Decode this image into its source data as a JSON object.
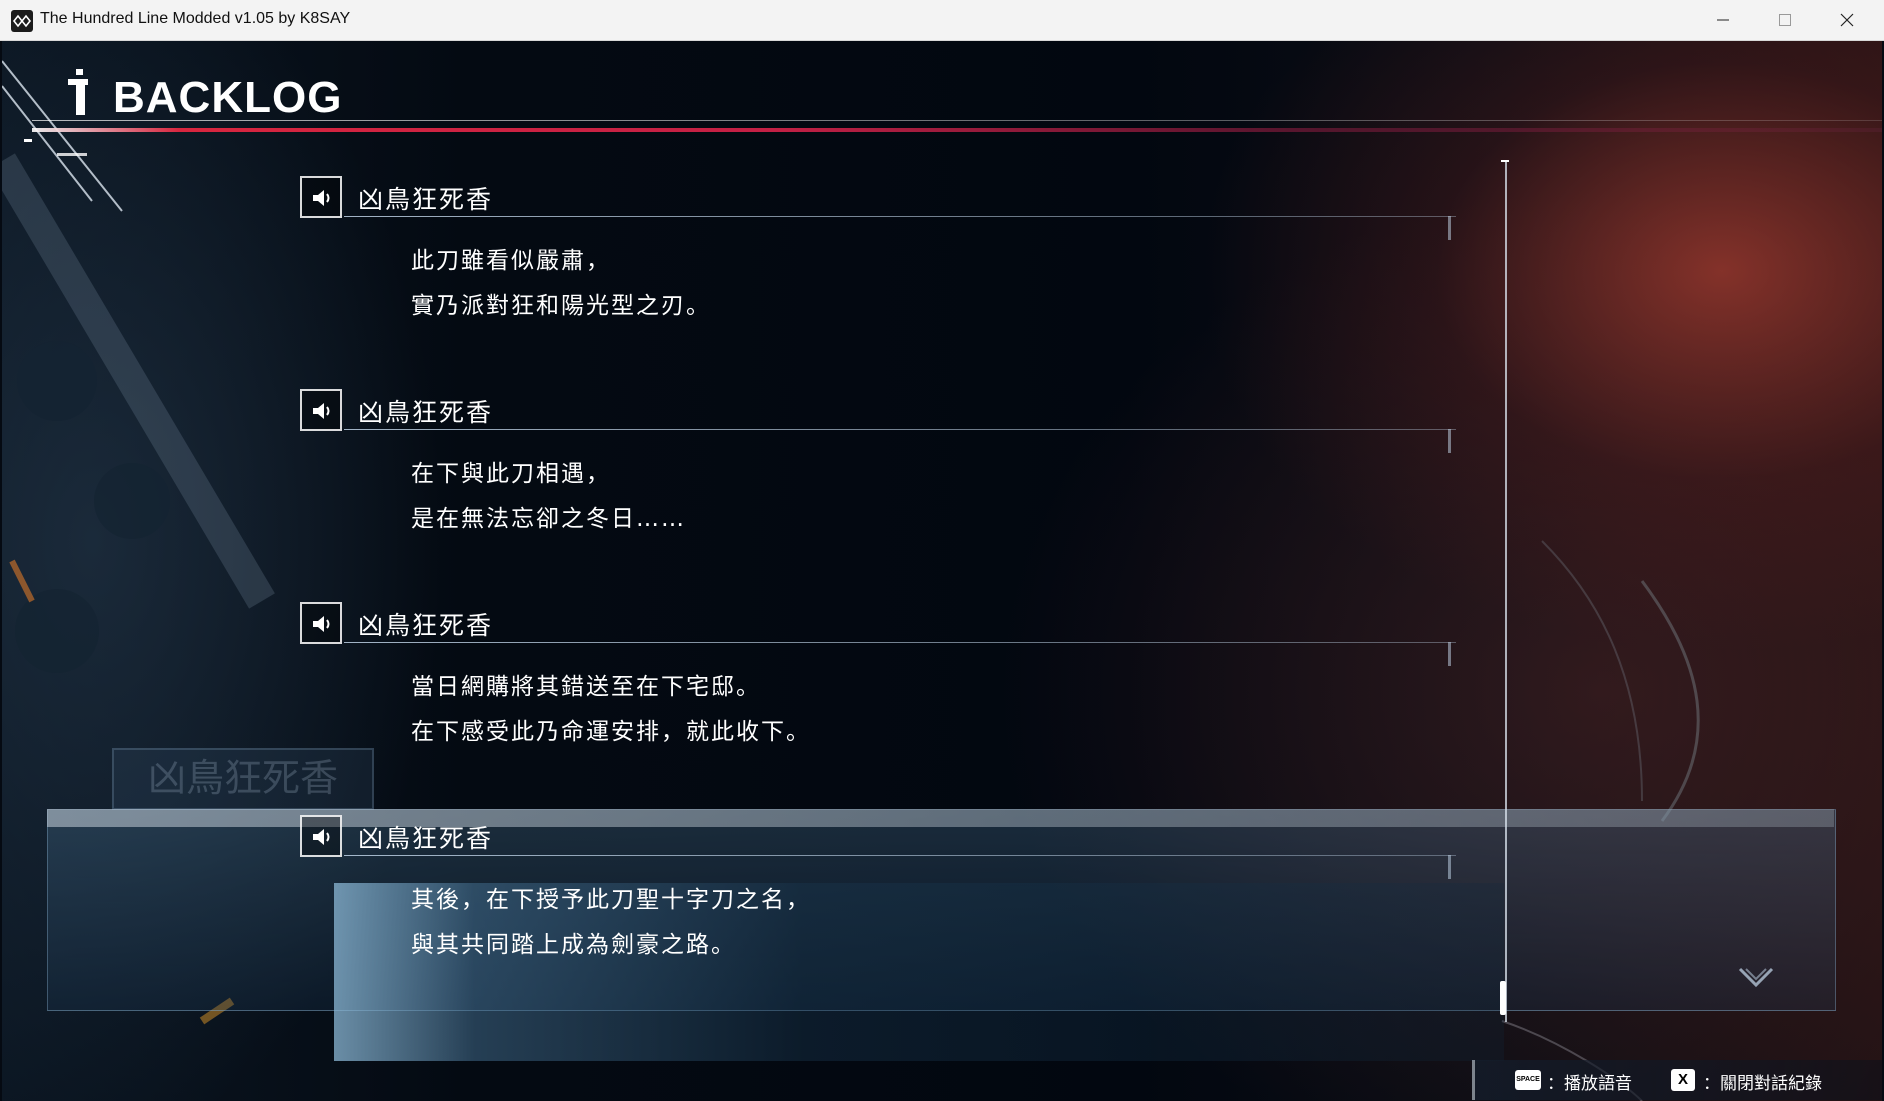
{
  "window": {
    "title": "The Hundred Line Modded v1.05 by K8SAY",
    "icon": "app-logo-icon",
    "controls": [
      "minimize-icon",
      "maximize-icon",
      "close-icon"
    ]
  },
  "header": {
    "title": "BACKLOG"
  },
  "background": {
    "dialog_name": "凶鳥狂死香"
  },
  "entries": [
    {
      "speaker": "凶鳥狂死香",
      "lines": [
        "此刀雖看似嚴肅，",
        "實乃派對狂和陽光型之刃。"
      ]
    },
    {
      "speaker": "凶鳥狂死香",
      "lines": [
        "在下與此刀相遇，",
        "是在無法忘卻之冬日……"
      ]
    },
    {
      "speaker": "凶鳥狂死香",
      "lines": [
        "當日網購將其錯送至在下宅邸。",
        "在下感受此乃命運安排，就此收下。"
      ]
    },
    {
      "speaker": "凶鳥狂死香",
      "lines": [
        "其後，在下授予此刀聖十字刀之名，",
        "與其共同踏上成為劍豪之路。"
      ],
      "selected": true
    }
  ],
  "controls": {
    "space_key": "SPACE",
    "space_label": "：播放語音",
    "x_key": "X",
    "x_label": "：關閉對話紀錄"
  },
  "colors": {
    "accent_red": "#d8263f",
    "panel_blue": "#8cb9d7",
    "titlebar": "#f3f3f3"
  }
}
